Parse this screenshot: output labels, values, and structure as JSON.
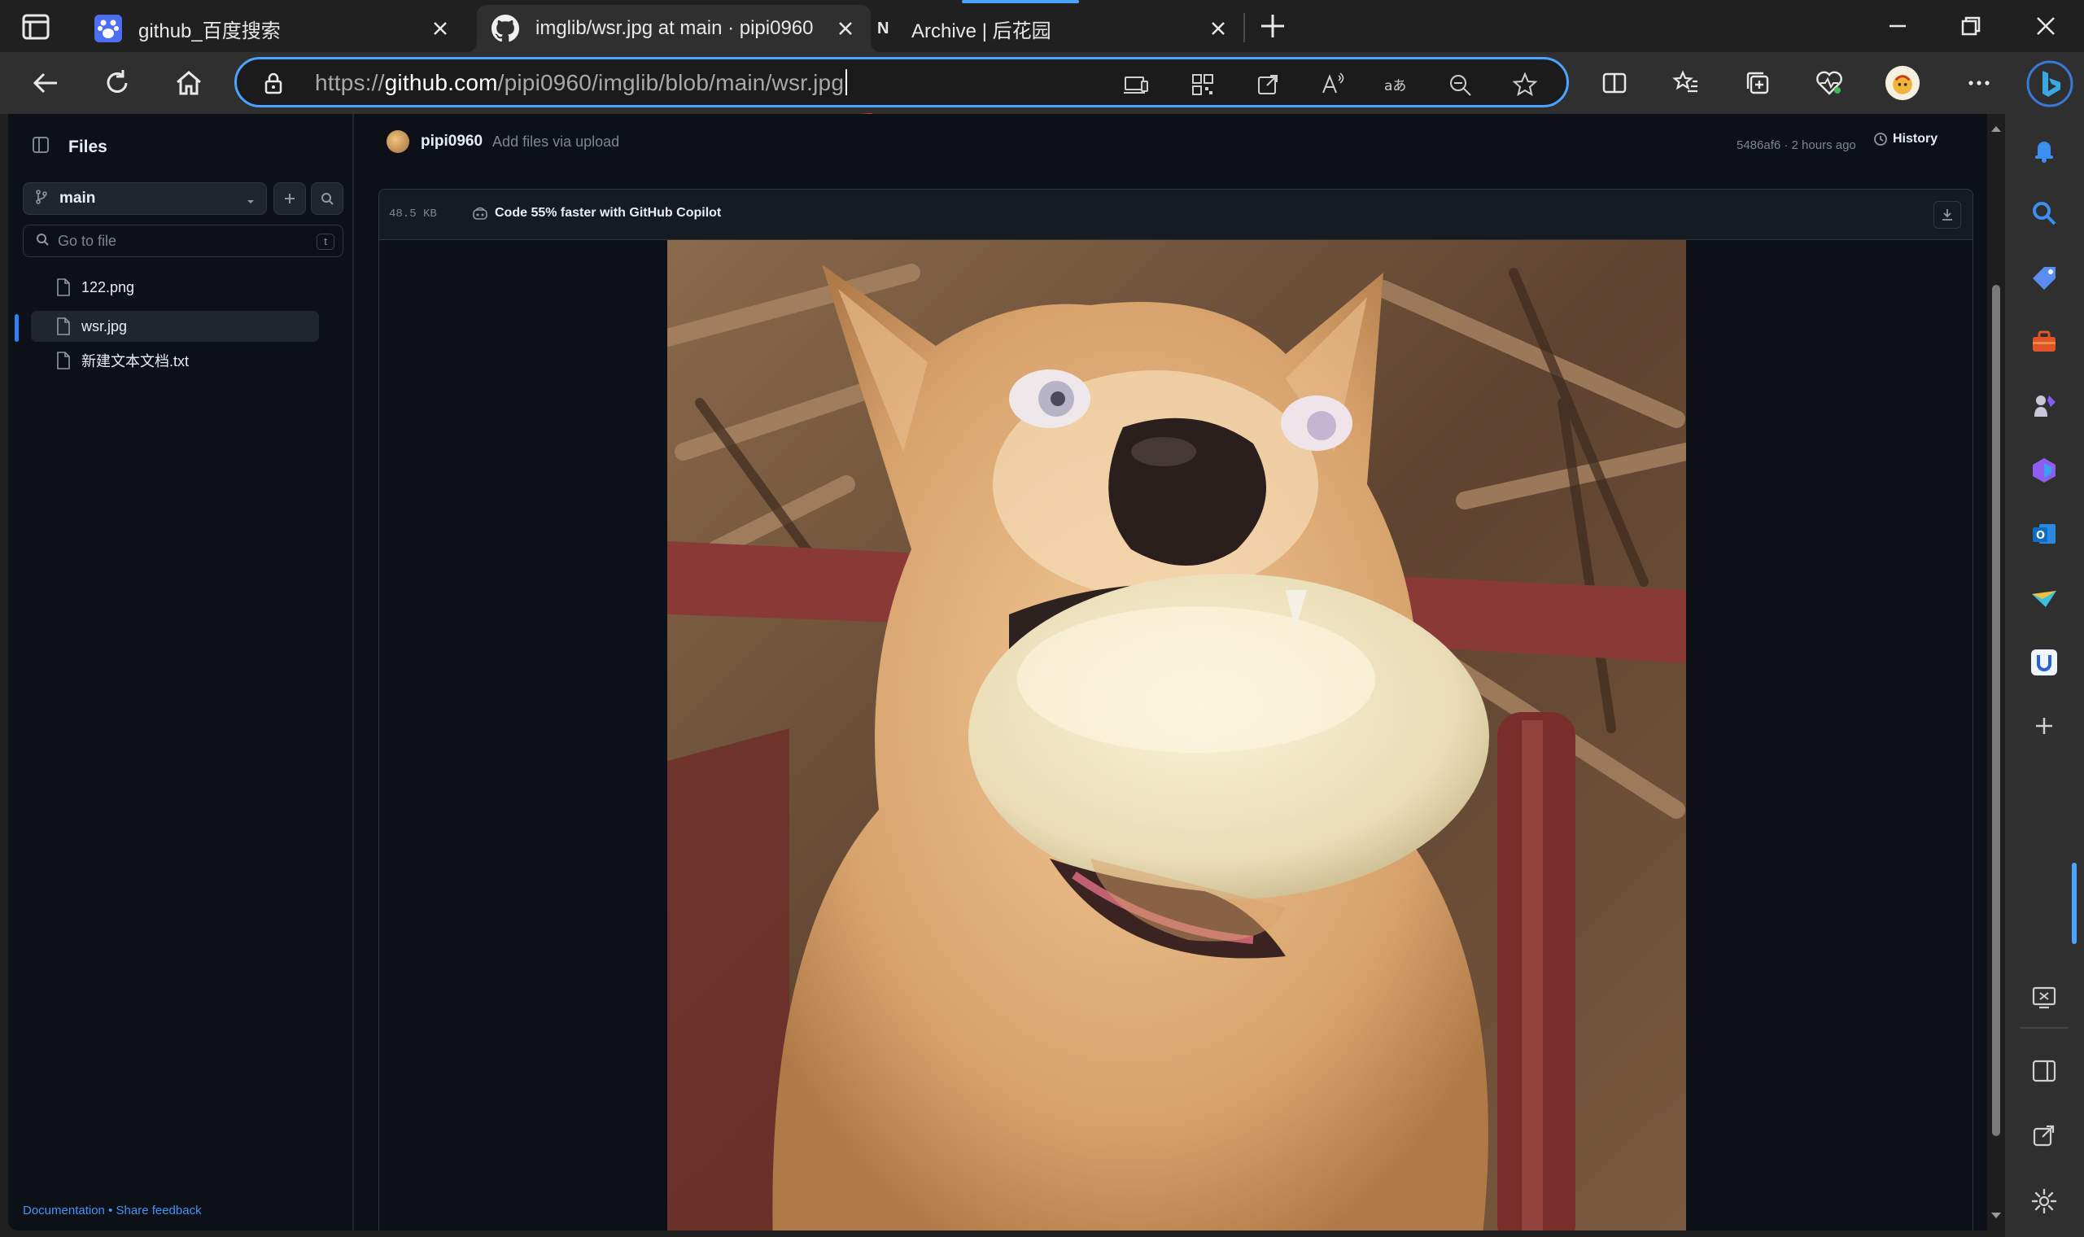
{
  "browser": {
    "tabs": [
      {
        "title": "github_百度搜索",
        "favicon": "baidu-paw-icon",
        "active": false
      },
      {
        "title": "imglib/wsr.jpg at main · pipi0960",
        "favicon": "github-icon",
        "active": true
      },
      {
        "title": "Archive | 后花园",
        "favicon": "N",
        "active": false
      }
    ],
    "address": {
      "prefix": "https://",
      "domain": "github.com",
      "path": "/pipi0960/imglib/blob/main/wsr.jpg"
    },
    "accent_color": "#4aa3ff",
    "annotation_color": "#e8322a"
  },
  "sidebar": {
    "title": "Files",
    "branch": "main",
    "goto_placeholder": "Go to file",
    "goto_shortcut": "t",
    "files": [
      {
        "name": "122.png",
        "active": false
      },
      {
        "name": "wsr.jpg",
        "active": true
      },
      {
        "name": "新建文本文档.txt",
        "active": false
      }
    ],
    "footer": {
      "documentation": "Documentation",
      "separator": "•",
      "feedback": "Share feedback"
    }
  },
  "commit": {
    "user": "pipi0960",
    "message": "Add files via upload",
    "info": "5486af6 · 2 hours ago",
    "history_label": "History"
  },
  "file": {
    "size": "48.5 KB",
    "copilot_label": "Code 55% faster with GitHub Copilot",
    "image_subject": "dog holding a round bun in its mouth"
  },
  "colors": {
    "page_bg": "#0d1117",
    "panel_bg": "#161b22",
    "border": "#30363d",
    "link": "#4493f8",
    "muted_text": "#7d8590"
  }
}
